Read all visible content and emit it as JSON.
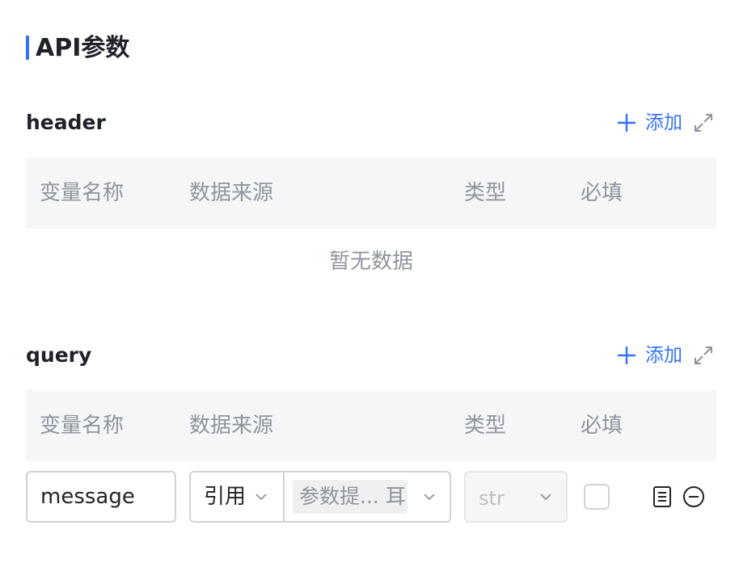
{
  "page": {
    "title": "API参数"
  },
  "header_section": {
    "label": "header",
    "add_label": "添加",
    "columns": [
      "变量名称",
      "数据来源",
      "类型",
      "必填"
    ],
    "empty_text": "暂无数据"
  },
  "query_section": {
    "label": "query",
    "add_label": "添加",
    "columns": [
      "变量名称",
      "数据来源",
      "类型",
      "必填"
    ],
    "rows": [
      {
        "name": "message",
        "source_type": "引用",
        "source_value": "参数提... 耳",
        "type": "str",
        "required": false
      }
    ]
  },
  "icons": {
    "add": "plus-icon",
    "expand": "expand-icon",
    "dropdown": "chevron-down-icon",
    "row_detail": "document-icon",
    "row_remove": "minus-circle-icon"
  },
  "colors": {
    "accent": "#3370ff",
    "header_bg": "#f5f6f7",
    "muted_text": "#8f959e",
    "border": "#d0d3d6"
  }
}
